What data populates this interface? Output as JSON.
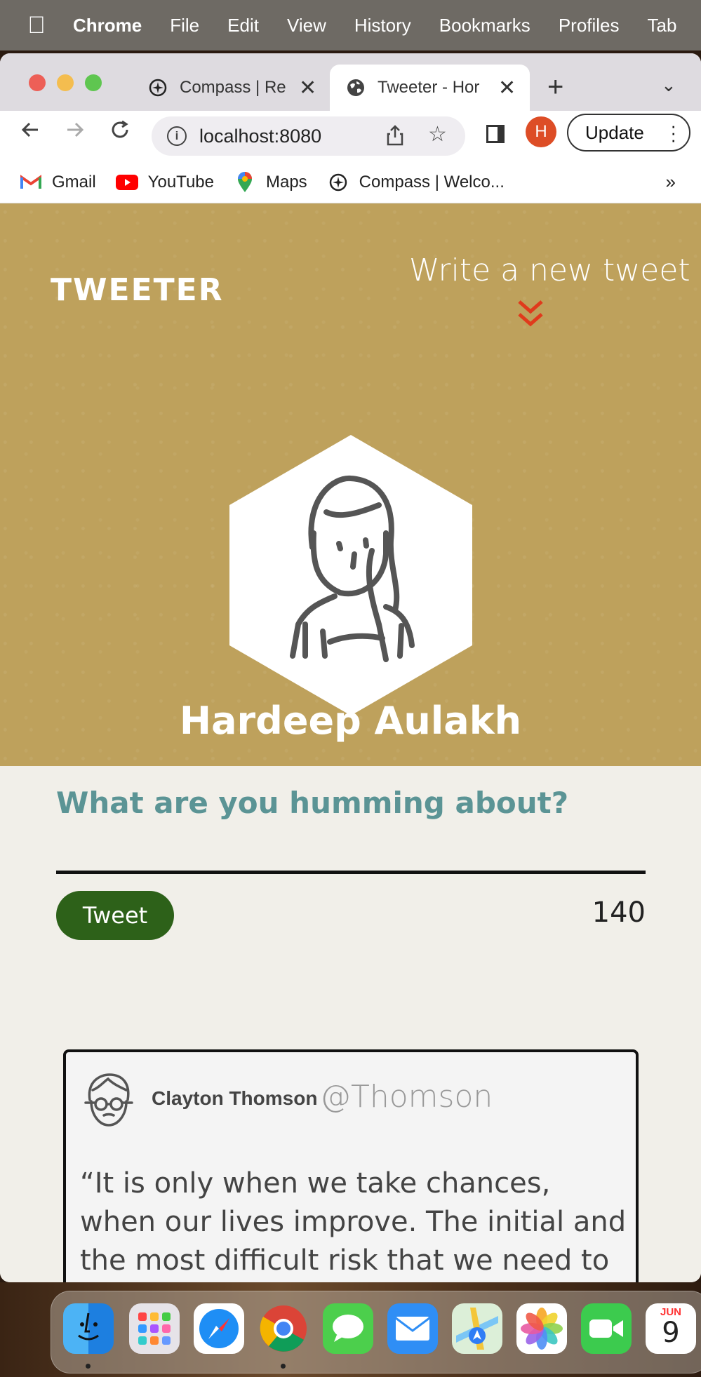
{
  "menubar": {
    "app": "Chrome",
    "items": [
      "File",
      "Edit",
      "View",
      "History",
      "Bookmarks",
      "Profiles",
      "Tab"
    ]
  },
  "tabs": [
    {
      "title": "Compass | Re",
      "icon": "compass-icon",
      "active": false
    },
    {
      "title": "Tweeter - Hor",
      "icon": "globe-icon",
      "active": true
    }
  ],
  "toolbar": {
    "url": "localhost:8080",
    "profile_initial": "H",
    "update_label": "Update"
  },
  "bookmarks": [
    {
      "label": "Gmail",
      "icon": "gmail-icon"
    },
    {
      "label": "YouTube",
      "icon": "youtube-icon"
    },
    {
      "label": "Maps",
      "icon": "maps-icon"
    },
    {
      "label": "Compass | Welco...",
      "icon": "compass-icon"
    }
  ],
  "bookmarks_more": "»",
  "page": {
    "brand": "TWEETER",
    "compose_link": "Write a new tweet",
    "user_name": "Hardeep Aulakh",
    "prompt": "What are you humming about?",
    "input_value": "",
    "tweet_button": "Tweet",
    "char_counter": "140",
    "accent_color": "#bea15c",
    "button_color": "#2d6119",
    "prompt_color": "#5b9495"
  },
  "tweet": {
    "name": "Clayton Thomson",
    "handle": "@Thomson",
    "body": "“It is only when we take chances, when our lives improve. The initial and the most difficult risk that we need to take is to become honest."
  },
  "dock": {
    "calendar_month": "JUN",
    "calendar_day": "9",
    "apps": [
      "finder",
      "launchpad",
      "safari",
      "chrome",
      "messages",
      "mail",
      "maps",
      "photos",
      "facetime",
      "calendar"
    ]
  }
}
